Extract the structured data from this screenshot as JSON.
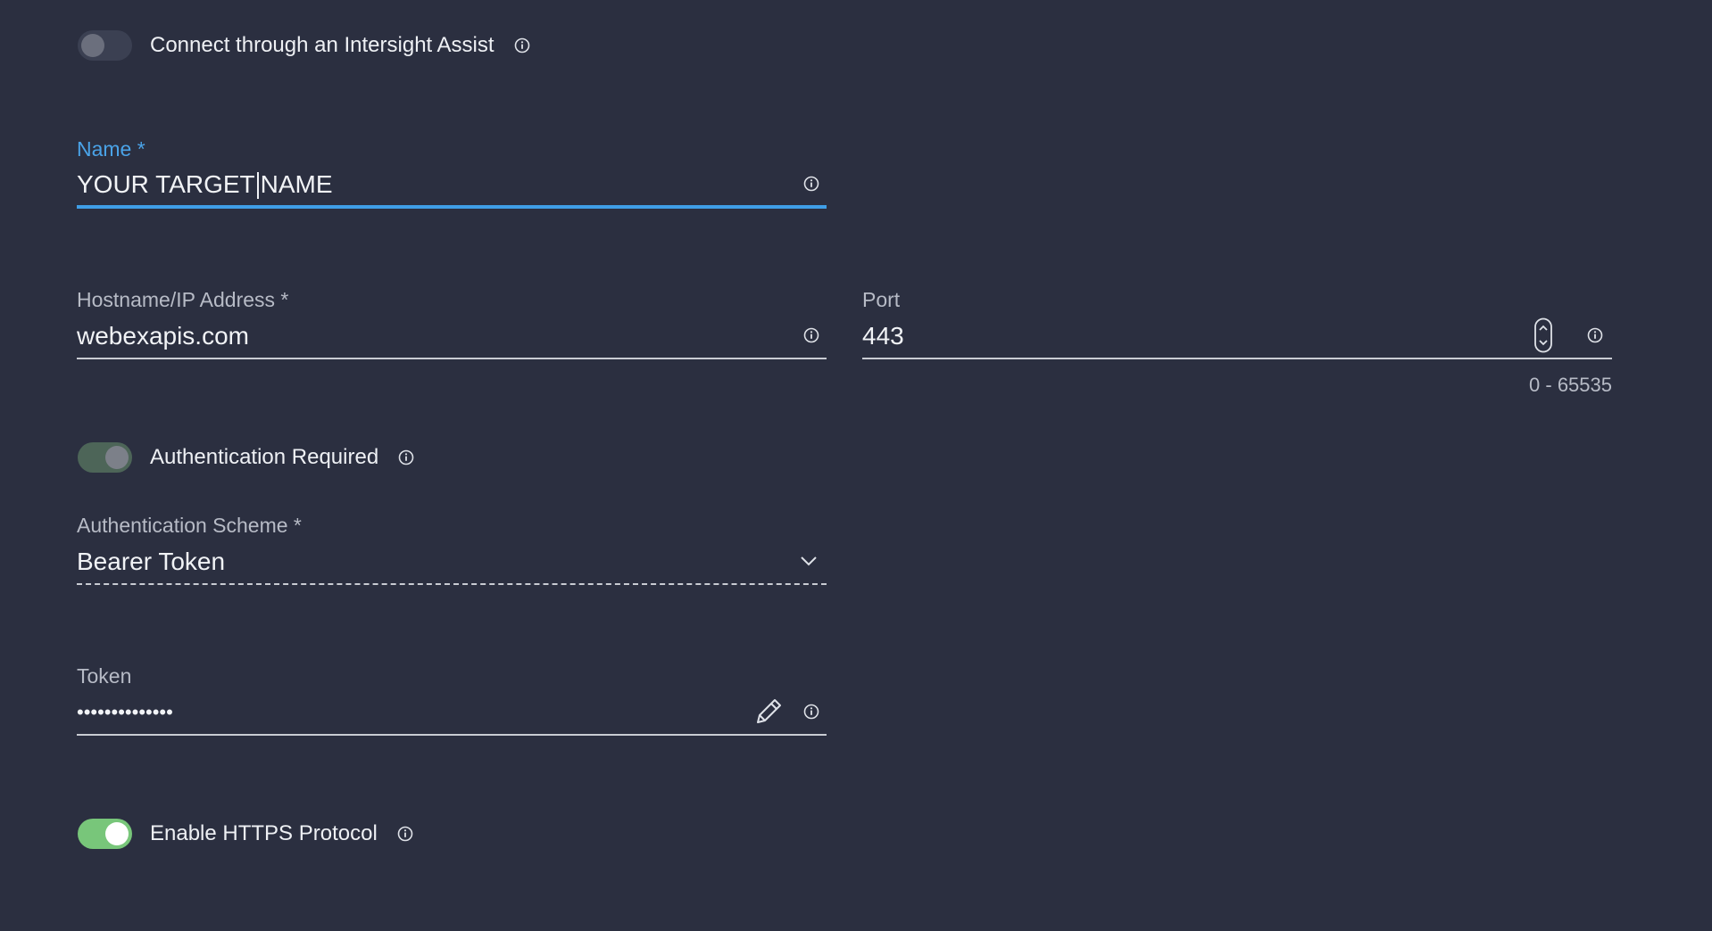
{
  "assist_toggle": {
    "label": "Connect through an Intersight Assist",
    "state": "off"
  },
  "name_field": {
    "label": "Name *",
    "value_before_cursor": "YOUR TARGET",
    "value_after_cursor": "NAME"
  },
  "hostname_field": {
    "label": "Hostname/IP Address *",
    "value": "webexapis.com"
  },
  "port_field": {
    "label": "Port",
    "value": "443",
    "hint": "0 - 65535"
  },
  "auth_toggle": {
    "label": "Authentication Required",
    "state": "on-disabled"
  },
  "auth_scheme_field": {
    "label": "Authentication Scheme *",
    "value": "Bearer Token"
  },
  "token_field": {
    "label": "Token",
    "value": "••••••••••••••"
  },
  "https_toggle": {
    "label": "Enable HTTPS Protocol",
    "state": "on"
  },
  "colors": {
    "background": "#2b2f40",
    "focus_blue": "#3f9ee6",
    "toggle_green": "#78c67a"
  },
  "icons": [
    "info-icon",
    "edit-pencil-icon",
    "chevron-down-icon",
    "stepper-icon"
  ]
}
